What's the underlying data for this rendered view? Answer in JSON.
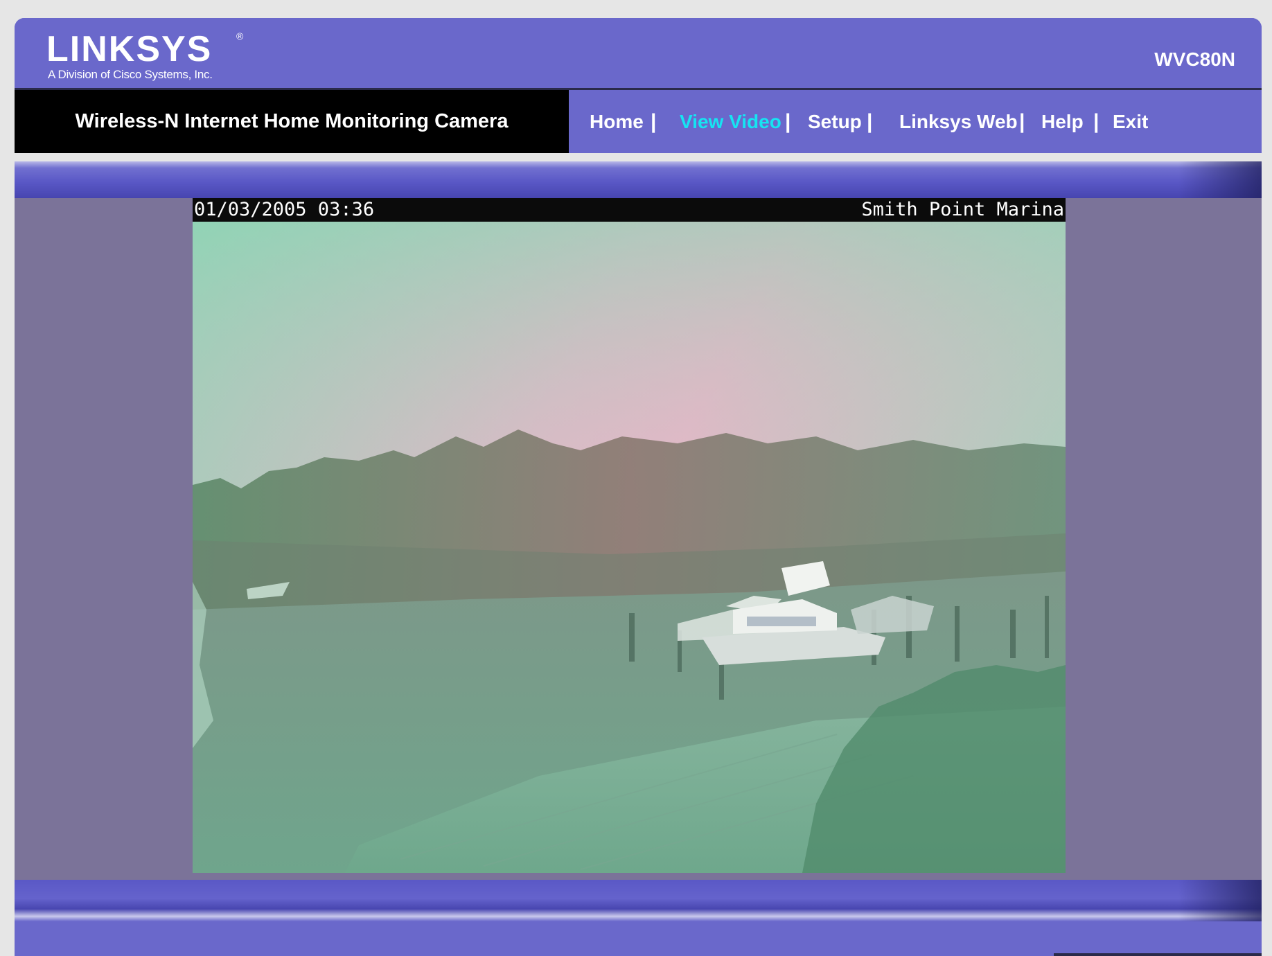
{
  "header": {
    "logo_text": "LINKSYS",
    "logo_registered": "®",
    "logo_subtitle": "A Division of Cisco Systems, Inc.",
    "model": "WVC80N"
  },
  "nav": {
    "product_name": "Wireless-N Internet Home Monitoring Camera",
    "items": [
      {
        "label": "Home",
        "active": false
      },
      {
        "label": "View Video",
        "active": true
      },
      {
        "label": "Setup",
        "active": false
      },
      {
        "label": "Linksys Web",
        "active": false
      },
      {
        "label": "Help",
        "active": false
      },
      {
        "label": "Exit",
        "active": false
      }
    ],
    "separator": "|"
  },
  "video": {
    "timestamp": "01/03/2005 03:36",
    "location": "Smith Point Marina"
  },
  "colors": {
    "brand_purple": "#6a68cb",
    "active_link": "#16e4f2",
    "video_frame": "#7b7399"
  }
}
